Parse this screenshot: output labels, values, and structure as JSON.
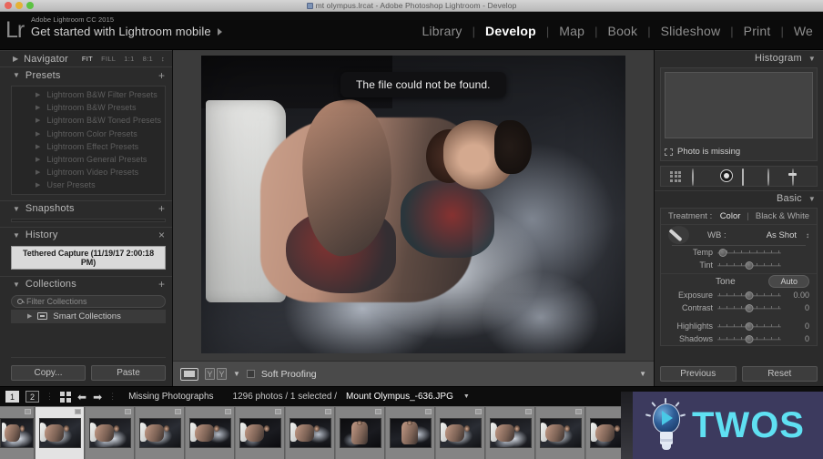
{
  "window": {
    "title": "mt olympus.lrcat - Adobe Photoshop Lightroom - Develop",
    "doc_icon": "document-icon"
  },
  "identity": {
    "logo": "Lr",
    "product": "Adobe Lightroom CC 2015",
    "tagline": "Get started with Lightroom mobile",
    "arrow_icon": "play-arrow-icon"
  },
  "modules": [
    {
      "label": "Library",
      "active": false
    },
    {
      "label": "Develop",
      "active": true
    },
    {
      "label": "Map",
      "active": false
    },
    {
      "label": "Book",
      "active": false
    },
    {
      "label": "Slideshow",
      "active": false
    },
    {
      "label": "Print",
      "active": false
    },
    {
      "label": "We",
      "active": false
    }
  ],
  "left_panel": {
    "navigator": {
      "title": "Navigator",
      "collapse_icon": "triangle-right-icon",
      "zoom_levels": [
        "FIT",
        "FILL",
        "1:1",
        "8:1"
      ],
      "active_zoom": "FIT",
      "stepper_icon": "stepper-icon"
    },
    "presets": {
      "title": "Presets",
      "collapse_icon": "triangle-down-icon",
      "add_icon": "plus-icon",
      "items": [
        "Lightroom B&W Filter Presets",
        "Lightroom B&W Presets",
        "Lightroom B&W Toned Presets",
        "Lightroom Color Presets",
        "Lightroom Effect Presets",
        "Lightroom General Presets",
        "Lightroom Video Presets",
        "User Presets"
      ]
    },
    "snapshots": {
      "title": "Snapshots",
      "collapse_icon": "triangle-down-icon",
      "add_icon": "plus-icon"
    },
    "history": {
      "title": "History",
      "collapse_icon": "triangle-down-icon",
      "clear_icon": "close-icon",
      "items": [
        "Tethered Capture (11/19/17 2:00:18 PM)"
      ]
    },
    "collections": {
      "title": "Collections",
      "collapse_icon": "triangle-down-icon",
      "add_icon": "plus-icon",
      "filter_placeholder": "Filter Collections",
      "filter_value": "",
      "search_icon": "search-icon",
      "items": [
        {
          "label": "Smart Collections",
          "icon": "collection-set-icon"
        }
      ]
    },
    "buttons": {
      "copy": "Copy...",
      "paste": "Paste"
    }
  },
  "center": {
    "tooltip": "The file could not be found.",
    "toolbar": {
      "view_icon": "loupe-view-icon",
      "flag_icons": [
        "flag-y-icon",
        "flag-y-icon"
      ],
      "caret_icon": "chevron-down-icon",
      "soft_proofing_label": "Soft Proofing",
      "soft_proofing_checked": false,
      "collapse_icon": "chevron-down-icon"
    }
  },
  "right_panel": {
    "histogram": {
      "title": "Histogram",
      "collapse_icon": "triangle-down-icon",
      "missing_label": "Photo is missing",
      "missing_icon": "missing-photo-icon"
    },
    "tools": [
      "crop-overlay-icon",
      "spot-removal-icon",
      "red-eye-icon",
      "graduated-filter-icon",
      "radial-filter-icon",
      "adjustment-brush-icon"
    ],
    "basic": {
      "title": "Basic",
      "collapse_icon": "triangle-down-icon",
      "treatment_label": "Treatment :",
      "treatment_options": [
        "Color",
        "Black & White"
      ],
      "treatment_selected": "Color",
      "eyedropper_icon": "eyedropper-icon",
      "wb_label": "WB :",
      "wb_value": "As Shot",
      "wb_stepper_icon": "stepper-icon",
      "wb_sliders": [
        {
          "label": "Temp",
          "value": "",
          "pos": 8
        },
        {
          "label": "Tint",
          "value": "",
          "pos": 50
        }
      ],
      "tone_label": "Tone",
      "auto_label": "Auto",
      "tone_sliders": [
        {
          "label": "Exposure",
          "value": "0.00",
          "pos": 50
        },
        {
          "label": "Contrast",
          "value": "0",
          "pos": 50
        },
        {
          "label": "Highlights",
          "value": "0",
          "pos": 50
        },
        {
          "label": "Shadows",
          "value": "0",
          "pos": 50
        }
      ]
    },
    "buttons": {
      "previous": "Previous",
      "reset": "Reset"
    }
  },
  "filmstrip_bar": {
    "pages": [
      "1",
      "2"
    ],
    "active_page": "1",
    "grid_icon": "grid-view-icon",
    "back_icon": "arrow-left-icon",
    "forward_icon": "arrow-right-icon",
    "source": "Missing Photographs",
    "count_prefix": "1296 photos / 1 selected /",
    "filename": "Mount Olympus_-636.JPG",
    "caret_icon": "chevron-down-icon"
  },
  "filmstrip": {
    "selected_index": 1,
    "thumbnails": [
      {
        "variant": "v1",
        "pose": "lying"
      },
      {
        "variant": "v2",
        "pose": "lying"
      },
      {
        "variant": "v1",
        "pose": "lying"
      },
      {
        "variant": "v2",
        "pose": "lying"
      },
      {
        "variant": "v3",
        "pose": "lying"
      },
      {
        "variant": "v4",
        "pose": "lying"
      },
      {
        "variant": "v3",
        "pose": "lying"
      },
      {
        "variant": "v4",
        "pose": "upright"
      },
      {
        "variant": "v3",
        "pose": "upright"
      },
      {
        "variant": "v2",
        "pose": "lying"
      },
      {
        "variant": "v1",
        "pose": "lying"
      },
      {
        "variant": "v2",
        "pose": "lying"
      },
      {
        "variant": "v4",
        "pose": "lying"
      }
    ]
  },
  "watermark": {
    "text": "TWOS",
    "icon": "lightbulb-icon",
    "background": "#3c3a5e",
    "accent": "#5fe0f2"
  }
}
